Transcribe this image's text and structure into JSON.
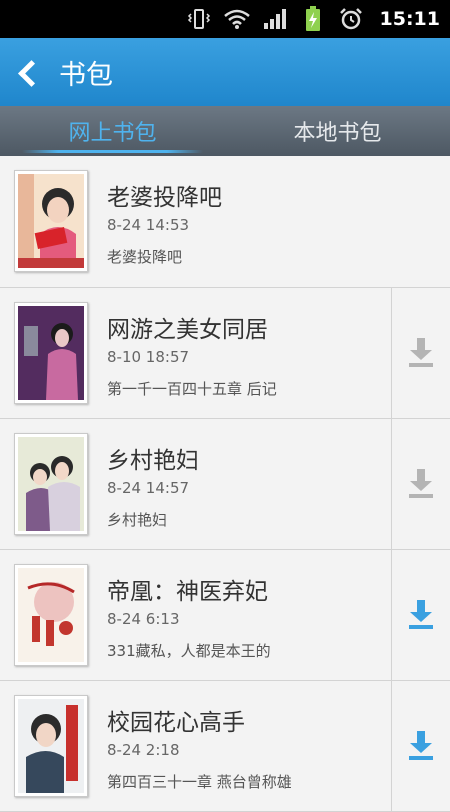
{
  "status_bar": {
    "time": "15:11",
    "icons": [
      "vibrate-icon",
      "wifi-icon",
      "signal-icon",
      "battery-charging-icon",
      "alarm-icon"
    ]
  },
  "header": {
    "title": "书包",
    "back_icon": "back-chevron-icon"
  },
  "tabs": [
    {
      "label": "网上书包",
      "active": true
    },
    {
      "label": "本地书包",
      "active": false
    }
  ],
  "colors": {
    "accent": "#2a93d6",
    "tab_active": "#4fb3ee",
    "download_active": "#3aa0e0",
    "download_inactive": "#b4b4b4"
  },
  "books": [
    {
      "title": "老婆投降吧",
      "date": "8-24 14:53",
      "chapter": "老婆投降吧",
      "download": "none"
    },
    {
      "title": "网游之美女同居",
      "date": "8-10 18:57",
      "chapter": "第一千一百四十五章 后记",
      "download": "inactive"
    },
    {
      "title": "乡村艳妇",
      "date": "8-24 14:57",
      "chapter": "乡村艳妇",
      "download": "inactive"
    },
    {
      "title": "帝凰：神医弃妃",
      "date": "8-24 6:13",
      "chapter": "331藏私，人都是本王的",
      "download": "active"
    },
    {
      "title": "校园花心高手",
      "date": "8-24 2:18",
      "chapter": "第四百三十一章 燕台曾称雄",
      "download": "active"
    }
  ]
}
